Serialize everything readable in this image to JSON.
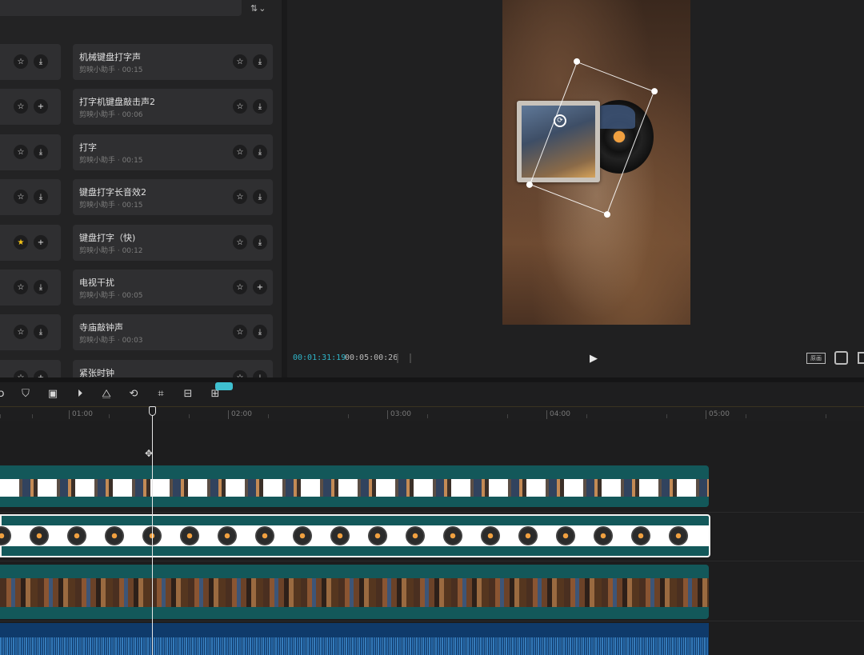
{
  "library": {
    "filter_icon": "filter-sort-icon",
    "left_cards": [
      {
        "star": "☆",
        "action": "⤓"
      },
      {
        "star": "☆",
        "action": "+"
      },
      {
        "star": "☆",
        "action": "⤓"
      },
      {
        "star": "☆",
        "action": "⤓"
      },
      {
        "star": "★",
        "action": "+",
        "favorited": true
      },
      {
        "star": "☆",
        "action": "⤓"
      },
      {
        "star": "☆",
        "action": "⤓"
      },
      {
        "star": "☆",
        "action": "+"
      }
    ],
    "items": [
      {
        "title": "机械键盘打字声",
        "meta": "剪映小助手 · 00:15",
        "action": "⤓"
      },
      {
        "title": "打字机键盘敲击声2",
        "meta": "剪映小助手 · 00:06",
        "action": "⤓"
      },
      {
        "title": "打字",
        "meta": "剪映小助手 · 00:15",
        "action": "⤓"
      },
      {
        "title": "键盘打字长音效2",
        "meta": "剪映小助手 · 00:15",
        "action": "⤓"
      },
      {
        "title": "键盘打字（快)",
        "meta": "剪映小助手 · 00:12",
        "action": "⤓"
      },
      {
        "title": "电视干扰",
        "meta": "剪映小助手 · 00:05",
        "action": "+"
      },
      {
        "title": "寺庙敲钟声",
        "meta": "剪映小助手 · 00:03",
        "action": "⤓"
      },
      {
        "title": "紧张时钟",
        "meta": "",
        "action": "⤓"
      }
    ],
    "star_glyph": "☆"
  },
  "player": {
    "current_time": "00:01:31:19",
    "total_time": "00:05:00:26",
    "play_glyph": "▶",
    "ratio_label": "原画",
    "rotate_glyph": "⟳"
  },
  "toolbar": {
    "badge": "",
    "tools": [
      "split-icon",
      "mask-icon",
      "freeze-icon",
      "speed-icon",
      "mirror-icon",
      "rotate-icon",
      "crop-icon",
      "caption-icon",
      "ai-icon"
    ]
  },
  "timeline": {
    "ticks": [
      "01:00",
      "02:00",
      "03:00",
      "04:00",
      "05:00"
    ],
    "playhead_time": "00:01:31:19"
  },
  "colors": {
    "accent": "#2fb4c8",
    "clip_teal": "#13585a",
    "audio_blue": "#0f3a6a",
    "favorite": "#f5c518"
  }
}
